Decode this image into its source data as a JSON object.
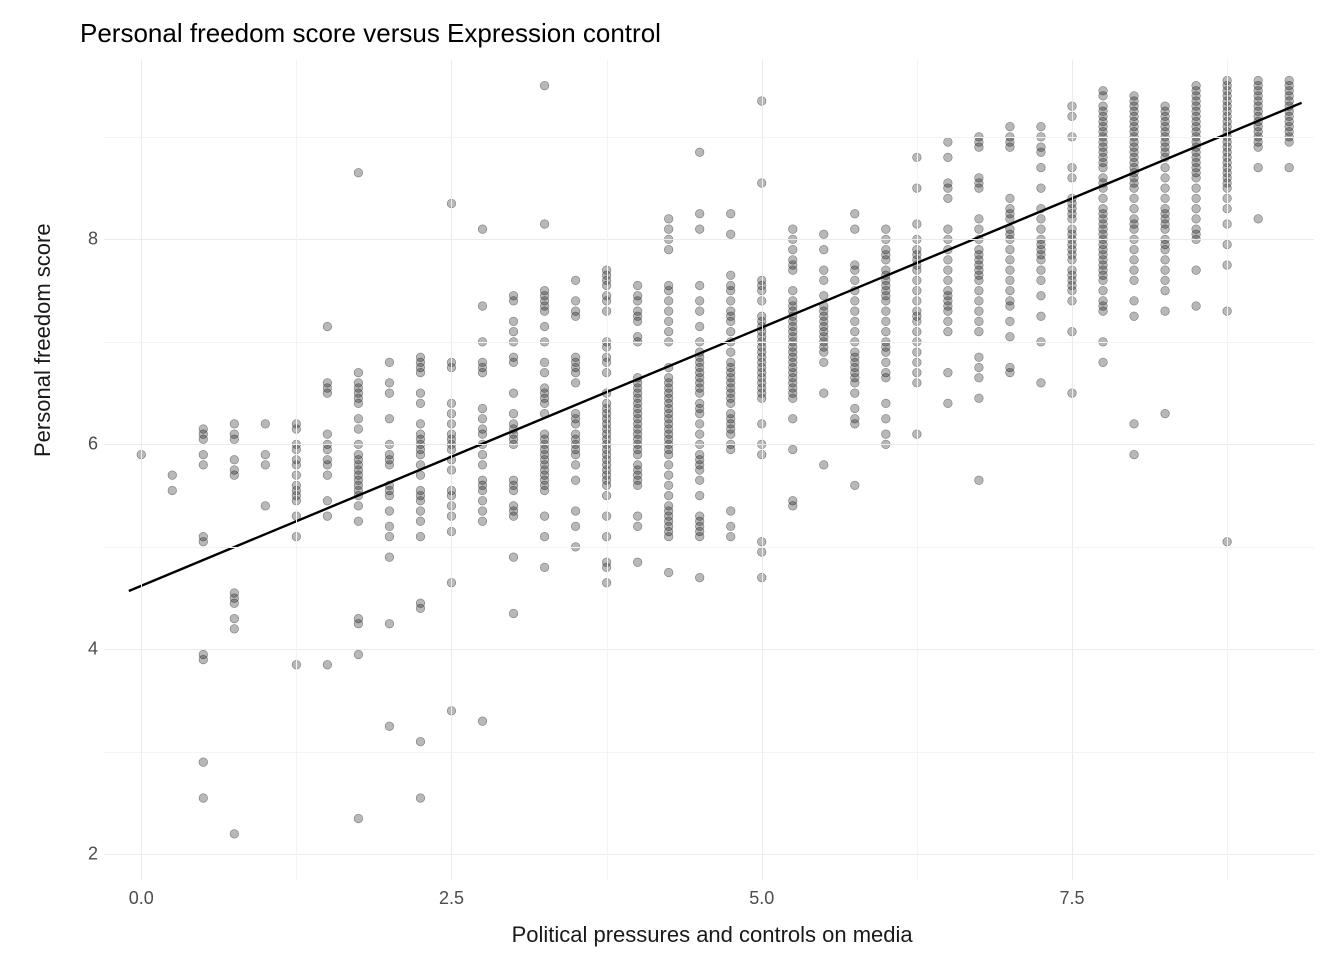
{
  "chart_data": {
    "type": "scatter",
    "title": "Personal freedom score versus Expression control",
    "xlabel": "Political pressures and controls on media",
    "ylabel": "Personal freedom score",
    "xlim": [
      -0.3,
      9.45
    ],
    "ylim": [
      1.75,
      9.75
    ],
    "x_ticks": [
      0.0,
      2.5,
      5.0,
      7.5
    ],
    "y_ticks": [
      2,
      4,
      6,
      8
    ],
    "regression": {
      "intercept": 4.62,
      "slope": 0.504,
      "x_from": -0.1,
      "x_to": 9.35
    },
    "columns": [
      {
        "x": 0.0,
        "ys": [
          5.9
        ]
      },
      {
        "x": 0.25,
        "ys": [
          5.55,
          5.7
        ]
      },
      {
        "x": 0.5,
        "ys": [
          2.55,
          2.9,
          3.9,
          3.95,
          5.05,
          5.1,
          5.8,
          5.9,
          6.05,
          6.1,
          6.15
        ]
      },
      {
        "x": 0.75,
        "ys": [
          2.2,
          4.2,
          4.3,
          4.45,
          4.5,
          4.55,
          5.7,
          5.75,
          5.85,
          6.05,
          6.1,
          6.2
        ]
      },
      {
        "x": 1.0,
        "ys": [
          5.4,
          5.8,
          5.9,
          6.2
        ]
      },
      {
        "x": 1.25,
        "ys": [
          3.85,
          5.1,
          5.3,
          5.45,
          5.5,
          5.55,
          5.6,
          5.7,
          5.8,
          5.85,
          5.95,
          6.0,
          6.15,
          6.2
        ]
      },
      {
        "x": 1.5,
        "ys": [
          3.85,
          5.3,
          5.45,
          5.7,
          5.8,
          5.85,
          5.95,
          6.0,
          6.1,
          6.5,
          6.55,
          6.6,
          7.15
        ]
      },
      {
        "x": 1.75,
        "ys": [
          2.35,
          3.95,
          4.25,
          4.3,
          5.25,
          5.4,
          5.5,
          5.55,
          5.6,
          5.65,
          5.7,
          5.75,
          5.8,
          5.85,
          5.9,
          6.0,
          6.15,
          6.25,
          6.4,
          6.45,
          6.5,
          6.55,
          6.6,
          6.7,
          8.65
        ]
      },
      {
        "x": 2.0,
        "ys": [
          3.25,
          4.25,
          4.9,
          5.1,
          5.2,
          5.35,
          5.5,
          5.55,
          5.6,
          5.8,
          5.85,
          5.9,
          6.0,
          6.25,
          6.5,
          6.6,
          6.8
        ]
      },
      {
        "x": 2.25,
        "ys": [
          2.55,
          3.1,
          4.4,
          4.45,
          5.1,
          5.25,
          5.35,
          5.45,
          5.5,
          5.55,
          5.7,
          5.8,
          5.9,
          5.95,
          6.0,
          6.05,
          6.1,
          6.2,
          6.4,
          6.5,
          6.7,
          6.75,
          6.8,
          6.85
        ]
      },
      {
        "x": 2.5,
        "ys": [
          3.4,
          4.65,
          5.15,
          5.3,
          5.4,
          5.5,
          5.55,
          5.75,
          5.85,
          5.95,
          6.0,
          6.05,
          6.1,
          6.2,
          6.3,
          6.4,
          6.75,
          6.8,
          8.35
        ]
      },
      {
        "x": 2.75,
        "ys": [
          3.3,
          5.25,
          5.35,
          5.45,
          5.55,
          5.6,
          5.65,
          5.8,
          5.9,
          6.0,
          6.1,
          6.15,
          6.25,
          6.35,
          6.7,
          6.75,
          6.8,
          7.0,
          7.35,
          8.1
        ]
      },
      {
        "x": 3.0,
        "ys": [
          4.35,
          4.9,
          5.3,
          5.35,
          5.4,
          5.55,
          5.6,
          5.65,
          6.0,
          6.05,
          6.1,
          6.15,
          6.2,
          6.3,
          6.5,
          6.8,
          6.85,
          7.0,
          7.1,
          7.2,
          7.4,
          7.45
        ]
      },
      {
        "x": 3.25,
        "ys": [
          4.8,
          5.1,
          5.3,
          5.55,
          5.6,
          5.65,
          5.7,
          5.75,
          5.8,
          5.85,
          5.9,
          5.95,
          6.0,
          6.05,
          6.1,
          6.3,
          6.4,
          6.45,
          6.5,
          6.55,
          6.7,
          6.8,
          7.0,
          7.15,
          7.3,
          7.35,
          7.4,
          7.45,
          7.5,
          8.15,
          9.5
        ]
      },
      {
        "x": 3.5,
        "ys": [
          5.0,
          5.2,
          5.35,
          5.65,
          5.8,
          5.9,
          5.95,
          6.0,
          6.05,
          6.1,
          6.2,
          6.25,
          6.3,
          6.6,
          6.7,
          6.75,
          6.8,
          6.85,
          7.25,
          7.3,
          7.4,
          7.6
        ]
      },
      {
        "x": 3.75,
        "ys": [
          4.65,
          4.8,
          4.85,
          5.1,
          5.3,
          5.5,
          5.6,
          5.65,
          5.7,
          5.75,
          5.8,
          5.85,
          5.9,
          5.95,
          6.0,
          6.05,
          6.1,
          6.15,
          6.2,
          6.25,
          6.3,
          6.35,
          6.4,
          6.5,
          6.7,
          6.8,
          6.85,
          6.95,
          7.0,
          7.3,
          7.4,
          7.45,
          7.55,
          7.6,
          7.65,
          7.7
        ]
      },
      {
        "x": 4.0,
        "ys": [
          4.85,
          5.2,
          5.3,
          5.6,
          5.65,
          5.7,
          5.75,
          5.8,
          5.9,
          5.95,
          6.0,
          6.05,
          6.1,
          6.15,
          6.2,
          6.25,
          6.3,
          6.35,
          6.4,
          6.45,
          6.5,
          6.55,
          6.6,
          6.65,
          7.0,
          7.05,
          7.2,
          7.25,
          7.3,
          7.4,
          7.45,
          7.55
        ]
      },
      {
        "x": 4.25,
        "ys": [
          4.75,
          5.1,
          5.15,
          5.2,
          5.25,
          5.3,
          5.35,
          5.4,
          5.5,
          5.6,
          5.7,
          5.8,
          5.9,
          5.95,
          6.0,
          6.05,
          6.1,
          6.15,
          6.2,
          6.25,
          6.3,
          6.35,
          6.4,
          6.45,
          6.5,
          6.55,
          6.6,
          6.65,
          6.75,
          7.0,
          7.1,
          7.2,
          7.3,
          7.4,
          7.5,
          7.55,
          7.9,
          8.0,
          8.1,
          8.2
        ]
      },
      {
        "x": 4.5,
        "ys": [
          4.7,
          5.1,
          5.15,
          5.2,
          5.25,
          5.3,
          5.5,
          5.65,
          5.75,
          5.8,
          5.85,
          5.9,
          6.0,
          6.1,
          6.2,
          6.3,
          6.35,
          6.4,
          6.5,
          6.55,
          6.6,
          6.65,
          6.7,
          6.75,
          6.8,
          6.85,
          6.9,
          7.0,
          7.15,
          7.3,
          7.4,
          7.55,
          8.1,
          8.25,
          8.85
        ]
      },
      {
        "x": 4.75,
        "ys": [
          5.1,
          5.2,
          5.35,
          5.95,
          6.0,
          6.1,
          6.15,
          6.2,
          6.25,
          6.3,
          6.4,
          6.45,
          6.5,
          6.55,
          6.6,
          6.65,
          6.7,
          6.75,
          6.8,
          6.9,
          7.0,
          7.1,
          7.2,
          7.25,
          7.3,
          7.4,
          7.5,
          7.55,
          7.65,
          8.05,
          8.25
        ]
      },
      {
        "x": 5.0,
        "ys": [
          4.7,
          4.95,
          5.05,
          5.9,
          6.0,
          6.2,
          6.45,
          6.5,
          6.55,
          6.6,
          6.65,
          6.7,
          6.75,
          6.8,
          6.85,
          6.9,
          6.95,
          7.0,
          7.05,
          7.1,
          7.15,
          7.2,
          7.25,
          7.4,
          7.5,
          7.55,
          7.6,
          8.55,
          9.35
        ]
      },
      {
        "x": 5.25,
        "ys": [
          5.4,
          5.45,
          5.95,
          6.25,
          6.45,
          6.5,
          6.55,
          6.6,
          6.65,
          6.7,
          6.75,
          6.8,
          6.85,
          6.9,
          6.95,
          7.0,
          7.05,
          7.1,
          7.15,
          7.2,
          7.25,
          7.3,
          7.35,
          7.4,
          7.5,
          7.7,
          7.75,
          7.8,
          7.9,
          8.0,
          8.1
        ]
      },
      {
        "x": 5.5,
        "ys": [
          5.8,
          6.5,
          6.8,
          6.9,
          6.95,
          7.0,
          7.05,
          7.1,
          7.15,
          7.2,
          7.25,
          7.3,
          7.35,
          7.45,
          7.6,
          7.7,
          7.9,
          8.05
        ]
      },
      {
        "x": 5.75,
        "ys": [
          5.6,
          6.2,
          6.25,
          6.35,
          6.5,
          6.6,
          6.65,
          6.7,
          6.75,
          6.8,
          6.85,
          6.9,
          7.0,
          7.1,
          7.2,
          7.3,
          7.4,
          7.5,
          7.6,
          7.7,
          7.75,
          8.1,
          8.25
        ]
      },
      {
        "x": 6.0,
        "ys": [
          6.0,
          6.1,
          6.25,
          6.4,
          6.65,
          6.7,
          6.8,
          6.9,
          6.95,
          7.0,
          7.1,
          7.2,
          7.3,
          7.4,
          7.45,
          7.5,
          7.55,
          7.6,
          7.65,
          7.7,
          7.8,
          7.85,
          7.9,
          8.0,
          8.1
        ]
      },
      {
        "x": 6.25,
        "ys": [
          6.1,
          6.6,
          6.7,
          6.8,
          6.9,
          7.0,
          7.1,
          7.2,
          7.25,
          7.3,
          7.4,
          7.5,
          7.6,
          7.7,
          7.75,
          7.8,
          7.85,
          7.9,
          8.0,
          8.15,
          8.5,
          8.8
        ]
      },
      {
        "x": 6.5,
        "ys": [
          6.4,
          6.7,
          7.1,
          7.2,
          7.3,
          7.35,
          7.4,
          7.45,
          7.5,
          7.6,
          7.7,
          7.8,
          7.9,
          8.0,
          8.1,
          8.4,
          8.5,
          8.55,
          8.8,
          8.95
        ]
      },
      {
        "x": 6.75,
        "ys": [
          5.65,
          6.45,
          6.65,
          6.75,
          6.85,
          7.1,
          7.2,
          7.3,
          7.4,
          7.5,
          7.6,
          7.65,
          7.7,
          7.75,
          7.8,
          7.85,
          7.9,
          8.0,
          8.1,
          8.2,
          8.5,
          8.55,
          8.6,
          8.9,
          8.95,
          9.0
        ]
      },
      {
        "x": 7.0,
        "ys": [
          6.7,
          6.75,
          7.05,
          7.2,
          7.35,
          7.4,
          7.5,
          7.6,
          7.7,
          7.8,
          7.9,
          8.0,
          8.05,
          8.1,
          8.2,
          8.25,
          8.3,
          8.4,
          8.9,
          8.95,
          9.0,
          9.1
        ]
      },
      {
        "x": 7.25,
        "ys": [
          6.6,
          7.0,
          7.25,
          7.45,
          7.6,
          7.7,
          7.8,
          7.85,
          7.9,
          7.95,
          8.0,
          8.1,
          8.2,
          8.3,
          8.5,
          8.7,
          8.85,
          8.9,
          9.0,
          9.1
        ]
      },
      {
        "x": 7.5,
        "ys": [
          6.5,
          7.1,
          7.4,
          7.5,
          7.55,
          7.6,
          7.65,
          7.7,
          7.8,
          7.85,
          7.9,
          7.95,
          8.0,
          8.05,
          8.1,
          8.2,
          8.25,
          8.3,
          8.35,
          8.4,
          8.6,
          8.7,
          9.0,
          9.2,
          9.3
        ]
      },
      {
        "x": 7.75,
        "ys": [
          6.8,
          7.0,
          7.3,
          7.35,
          7.4,
          7.5,
          7.6,
          7.65,
          7.7,
          7.75,
          7.8,
          7.85,
          7.9,
          7.95,
          8.0,
          8.05,
          8.1,
          8.15,
          8.2,
          8.25,
          8.3,
          8.4,
          8.5,
          8.55,
          8.6,
          8.7,
          8.75,
          8.8,
          8.85,
          8.9,
          8.95,
          9.0,
          9.05,
          9.1,
          9.15,
          9.2,
          9.25,
          9.3,
          9.4,
          9.45
        ]
      },
      {
        "x": 8.0,
        "ys": [
          5.9,
          6.2,
          7.25,
          7.4,
          7.6,
          7.7,
          7.8,
          7.9,
          8.0,
          8.1,
          8.15,
          8.2,
          8.3,
          8.4,
          8.5,
          8.55,
          8.6,
          8.65,
          8.7,
          8.75,
          8.8,
          8.85,
          8.9,
          8.95,
          9.0,
          9.05,
          9.1,
          9.15,
          9.2,
          9.25,
          9.3,
          9.35,
          9.4
        ]
      },
      {
        "x": 8.25,
        "ys": [
          6.3,
          7.3,
          7.5,
          7.6,
          7.7,
          7.8,
          7.9,
          7.95,
          8.0,
          8.1,
          8.15,
          8.2,
          8.25,
          8.3,
          8.4,
          8.5,
          8.6,
          8.7,
          8.8,
          8.85,
          8.9,
          8.95,
          9.0,
          9.05,
          9.1,
          9.15,
          9.2,
          9.25,
          9.3
        ]
      },
      {
        "x": 8.5,
        "ys": [
          7.35,
          7.7,
          8.0,
          8.05,
          8.1,
          8.2,
          8.3,
          8.4,
          8.5,
          8.6,
          8.65,
          8.7,
          8.75,
          8.8,
          8.85,
          8.9,
          8.95,
          9.0,
          9.05,
          9.1,
          9.15,
          9.2,
          9.25,
          9.3,
          9.35,
          9.4,
          9.45,
          9.5
        ]
      },
      {
        "x": 8.75,
        "ys": [
          5.05,
          7.3,
          7.75,
          7.95,
          8.15,
          8.3,
          8.4,
          8.5,
          8.55,
          8.6,
          8.65,
          8.7,
          8.75,
          8.8,
          8.85,
          8.9,
          8.95,
          9.0,
          9.05,
          9.1,
          9.15,
          9.2,
          9.25,
          9.3,
          9.35,
          9.4,
          9.45,
          9.5,
          9.55
        ]
      },
      {
        "x": 9.0,
        "ys": [
          8.2,
          8.7,
          8.9,
          8.95,
          9.0,
          9.05,
          9.1,
          9.15,
          9.2,
          9.25,
          9.3,
          9.35,
          9.4,
          9.45,
          9.5,
          9.55
        ]
      },
      {
        "x": 9.25,
        "ys": [
          8.7,
          8.95,
          9.0,
          9.05,
          9.1,
          9.15,
          9.2,
          9.25,
          9.3,
          9.35,
          9.4,
          9.45,
          9.5,
          9.55
        ]
      }
    ]
  }
}
